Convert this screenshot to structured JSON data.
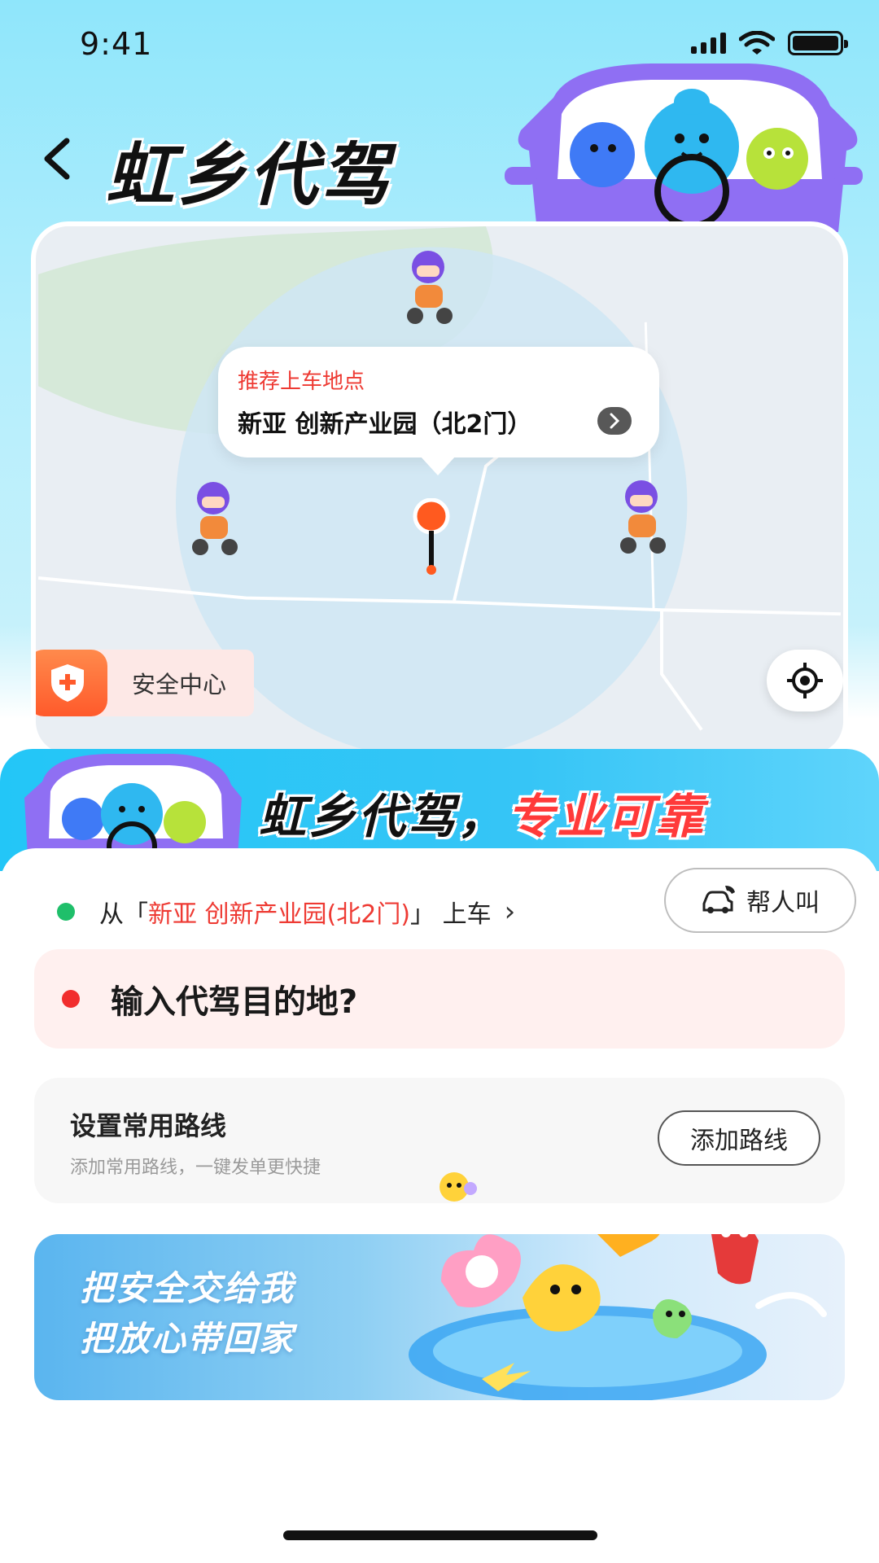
{
  "status_bar": {
    "time": "9:41"
  },
  "header": {
    "title": "虹乡代驾"
  },
  "map": {
    "callout": {
      "tag": "推荐上车地点",
      "place": "新亚 创新产业园（北2门）"
    },
    "safety_center_label": "安全中心"
  },
  "promo": {
    "slogan_black": "虹乡代驾，",
    "slogan_red": "专业可靠"
  },
  "sheet": {
    "pickup": {
      "prefix": "从「",
      "place": "新亚 创新产业园(北2门)",
      "suffix": "」 上车"
    },
    "help_call_label": "帮人叫",
    "destination_placeholder": "输入代驾目的地?",
    "common_route": {
      "title": "设置常用路线",
      "subtitle": "添加常用路线，一键发单更快捷",
      "button": "添加路线"
    },
    "banner": {
      "line1": "把安全交给我",
      "line2": "把放心带回家"
    }
  },
  "colors": {
    "accent_red": "#ee3a33",
    "green_dot": "#1fbf6a",
    "sky_blue": "#8fe6fb",
    "strip_blue": "#23c6f7"
  },
  "icons": [
    "back-arrow-icon",
    "signal-icon",
    "wifi-icon",
    "battery-icon",
    "shield-plus-icon",
    "locate-icon",
    "chevron-right-icon",
    "car-phone-icon"
  ]
}
